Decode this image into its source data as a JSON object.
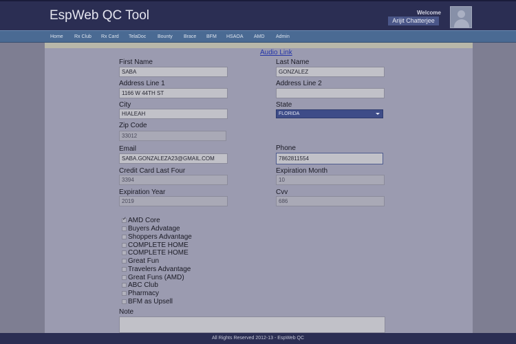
{
  "header": {
    "app_title": "EspWeb QC Tool",
    "welcome_label": "Welcome",
    "user_name": "Arijit Chatterjee"
  },
  "nav": {
    "items": [
      "Home",
      "Rx Club",
      "Rx Card",
      "TelaDoc",
      "Bounty",
      "Brace",
      "BFM",
      "HSAOA",
      "AMD",
      "Admin"
    ]
  },
  "form": {
    "audio_link": "Audio Link",
    "first_name": {
      "label": "First Name",
      "value": "SABA"
    },
    "last_name": {
      "label": "Last Name",
      "value": "GONZALEZ"
    },
    "address1": {
      "label": "Address Line 1",
      "value": "1166 W 44TH ST"
    },
    "address2": {
      "label": "Address Line 2",
      "value": ""
    },
    "city": {
      "label": "City",
      "value": "HIALEAH"
    },
    "state": {
      "label": "State",
      "value": "FLORIDA"
    },
    "zip": {
      "label": "Zip Code",
      "value": "33012"
    },
    "email": {
      "label": "Email",
      "value": "SABA.GONZALEZA23@GMAIL.COM"
    },
    "phone": {
      "label": "Phone",
      "value": "7862811554"
    },
    "cc_last_four": {
      "label": "Credit Card Last Four",
      "value": "3394"
    },
    "exp_month": {
      "label": "Expiration Month",
      "value": "10"
    },
    "exp_year": {
      "label": "Expiration Year",
      "value": "2019"
    },
    "cvv": {
      "label": "Cvv",
      "value": "686"
    },
    "note": {
      "label": "Note",
      "value": ""
    }
  },
  "products": [
    {
      "label": "AMD Core",
      "checked": true
    },
    {
      "label": "Buyers Advatage",
      "checked": false
    },
    {
      "label": "Shoppers Advantage",
      "checked": false
    },
    {
      "label": "COMPLETE HOME",
      "checked": false
    },
    {
      "label": "COMPLETE HOME",
      "checked": false
    },
    {
      "label": "Great Fun",
      "checked": false
    },
    {
      "label": "Travelers Advantage",
      "checked": false
    },
    {
      "label": "Great Funs (AMD)",
      "checked": false
    },
    {
      "label": "ABC Club",
      "checked": false
    },
    {
      "label": "Pharmacy",
      "checked": false
    },
    {
      "label": "BFM as Upsell",
      "checked": false
    }
  ],
  "footer": {
    "text": "All Rights Reserved 2012-13 - EspWeb QC"
  },
  "colors": {
    "header_bg": "#2b2e53",
    "nav_bg": "#4a6a93",
    "page_bg": "#9b9bb0",
    "link": "#2233a8"
  }
}
